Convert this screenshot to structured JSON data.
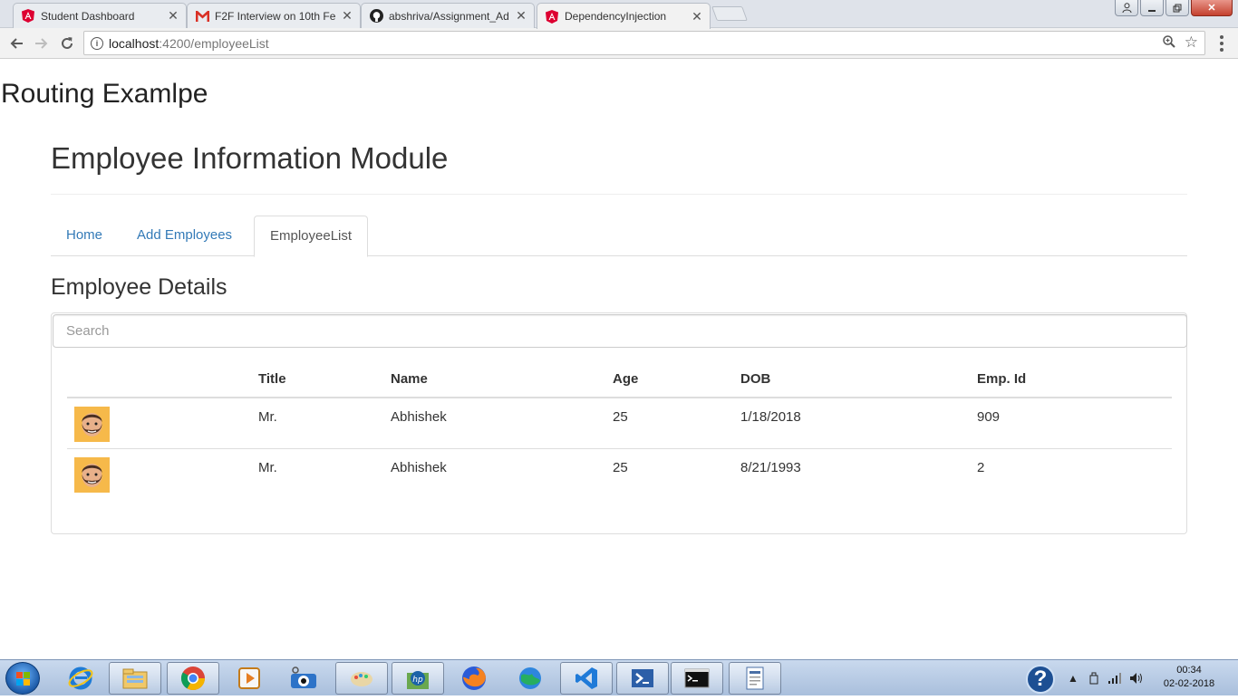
{
  "browser": {
    "tabs": [
      {
        "label": "Student Dashboard",
        "icon": "angular-icon"
      },
      {
        "label": "F2F Interview on 10th Fe",
        "icon": "gmail-icon"
      },
      {
        "label": "abshriva/Assignment_Ad",
        "icon": "github-icon"
      },
      {
        "label": "DependencyInjection",
        "icon": "angular-icon",
        "active": true
      }
    ],
    "url_host": "localhost",
    "url_path": ":4200/employeeList"
  },
  "page": {
    "routing_title": "Routing Examlpe",
    "module_title": "Employee Information Module",
    "nav": {
      "home": "Home",
      "add": "Add Employees",
      "list": "EmployeeList",
      "active": "EmployeeList"
    },
    "details_title": "Employee Details",
    "search_placeholder": "Search",
    "table": {
      "headers": {
        "title": "Title",
        "name": "Name",
        "age": "Age",
        "dob": "DOB",
        "empid": "Emp. Id"
      },
      "rows": [
        {
          "title": "Mr.",
          "name": "Abhishek",
          "age": "25",
          "dob": "1/18/2018",
          "empid": "909"
        },
        {
          "title": "Mr.",
          "name": "Abhishek",
          "age": "25",
          "dob": "8/21/1993",
          "empid": "2"
        }
      ]
    }
  },
  "taskbar": {
    "time": "00:34",
    "date": "02-02-2018"
  },
  "colors": {
    "link": "#337ab7",
    "avatar_bg": "#f6b94a"
  }
}
